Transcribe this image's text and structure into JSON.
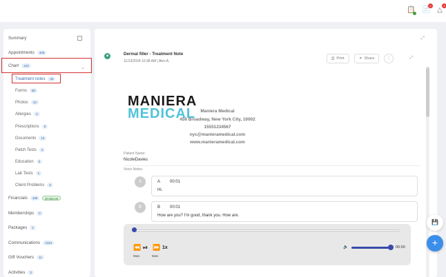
{
  "header": {
    "badges": {
      "tasks": "",
      "messages": "2",
      "alerts": "3"
    }
  },
  "sidebar": {
    "summary": "Summary",
    "appointments": {
      "label": "Appointments",
      "count": "406"
    },
    "chart": {
      "label": "Chart",
      "count": "120"
    },
    "chart_sub": [
      {
        "label": "Treatment notes",
        "count": "26"
      },
      {
        "label": "Forms",
        "count": "80"
      },
      {
        "label": "Photos",
        "count": "13"
      },
      {
        "label": "Allergies",
        "count": "3"
      },
      {
        "label": "Prescriptions",
        "count": "5"
      },
      {
        "label": "Documents",
        "count": "10"
      },
      {
        "label": "Patch Tests",
        "count": "2"
      },
      {
        "label": "Education",
        "count": "0"
      },
      {
        "label": "Lab Tests",
        "count": "1"
      },
      {
        "label": "Client Problems",
        "count": "6"
      }
    ],
    "financials": {
      "label": "Financials",
      "count": "165",
      "amount": "$7405.00"
    },
    "memberships": {
      "label": "Memberships",
      "count": "0"
    },
    "packages": {
      "label": "Packages",
      "count": "1"
    },
    "communications": {
      "label": "Communications",
      "count": "1344"
    },
    "gift_vouchers": {
      "label": "Gift Vouchers",
      "count": "11"
    },
    "activities": {
      "label": "Activities",
      "count": "3"
    }
  },
  "note": {
    "title": "Dermal filler - Treatment Note",
    "subtitle": "11/13/2024 10:38 AM | Alex A.",
    "print": "Print",
    "share": "Share",
    "logo_line1": "MANIERA",
    "logo_line2": "MEDICAL",
    "clinic": {
      "name": "Maniera Medical",
      "address": "456 Broadway, New York City, 10002",
      "phone": "15551234567",
      "email": "nyc@manieramedical.com",
      "website": "www.manieramedical.com"
    },
    "patient_label": "Patient Name:",
    "patient_name": "NicoleDavies",
    "voice_label": "Voice Notes:",
    "voice_notes": [
      {
        "speaker": "A",
        "time": "00:01",
        "text": "Hi."
      },
      {
        "speaker": "B",
        "time": "00:01",
        "text": "How are you? I'm good, thank you. How are."
      }
    ],
    "player": {
      "back_label": "5sec",
      "fwd_label": "5sec",
      "speed": "1x",
      "time": "00:00"
    }
  },
  "colors": {
    "accent": "#3b8eea",
    "highlight": "#d32f2f",
    "logo_cyan": "#4fc3d9"
  }
}
